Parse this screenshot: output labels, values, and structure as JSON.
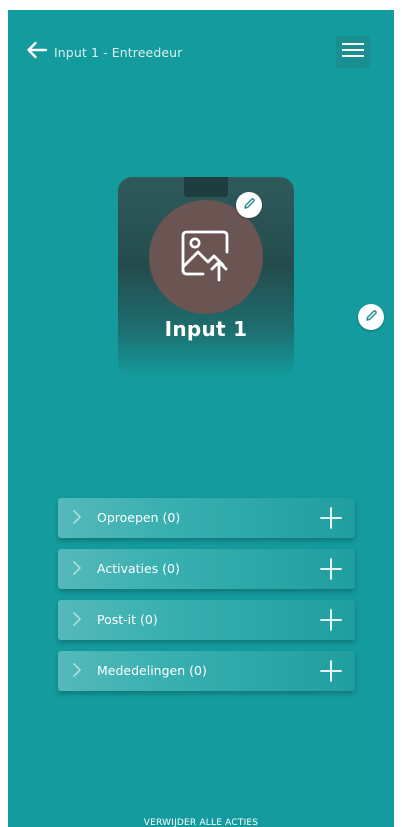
{
  "header": {
    "title": "Input 1 - Entreedeur",
    "back_icon": "arrow-left-icon",
    "menu_icon": "hamburger-menu-icon"
  },
  "card": {
    "title": "Input 1",
    "image_icon": "image-upload-icon",
    "edit_icon": "pencil-icon"
  },
  "side_edit_icon": "pencil-icon",
  "actions": [
    {
      "label": "Oproepen (0)"
    },
    {
      "label": "Activaties (0)"
    },
    {
      "label": "Post-it (0)"
    },
    {
      "label": "Mededelingen (0)"
    }
  ],
  "footer": {
    "delete_all_label": "VERWIJDER ALLE ACTIES"
  },
  "colors": {
    "background": "#149b9d",
    "card_dark": "#244c4d",
    "avatar": "#6a5553",
    "pencil": "#2a8e90"
  }
}
